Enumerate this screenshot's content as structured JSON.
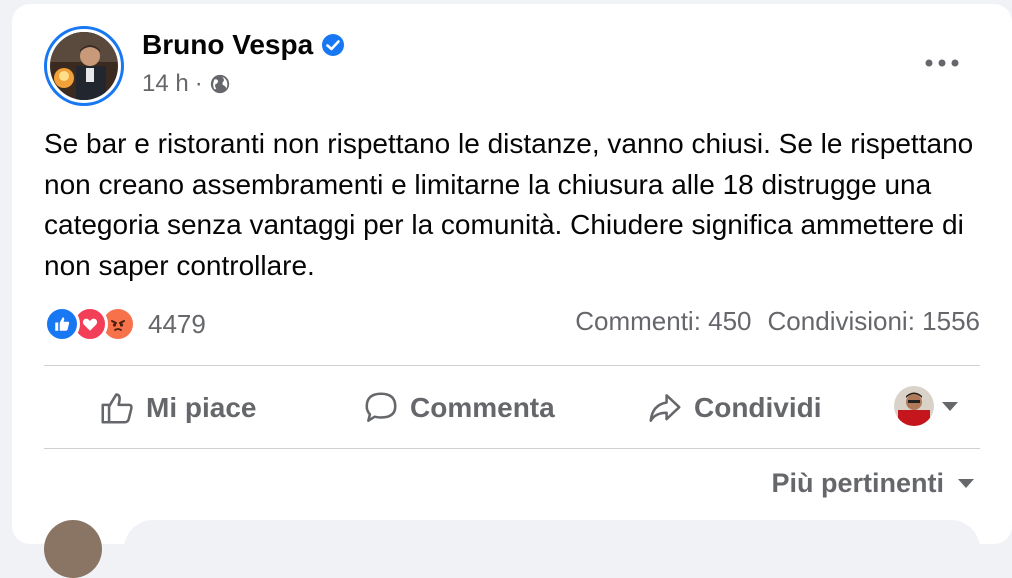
{
  "post": {
    "author": "Bruno Vespa",
    "time": "14 h",
    "separator": "·",
    "text": "Se bar e ristoranti non rispettano le distanze, vanno chiusi. Se le rispettano non creano assembramenti e limitarne la chiusura alle 18 distrugge una categoria senza vantaggi per la comunità. Chiudere significa ammettere di non saper controllare."
  },
  "reactions": {
    "icons": [
      "like-icon",
      "love-icon",
      "angry-icon"
    ],
    "count": "4479",
    "comments": "Commenti: 450",
    "shares": "Condivisioni: 1556"
  },
  "actions": {
    "like": "Mi piace",
    "comment": "Commenta",
    "share": "Condividi"
  },
  "sort": {
    "label": "Più pertinenti"
  },
  "colors": {
    "brand": "#1877f2",
    "secondary_text": "#65676b",
    "love": "#f33e58",
    "angry": "#f7714b"
  }
}
